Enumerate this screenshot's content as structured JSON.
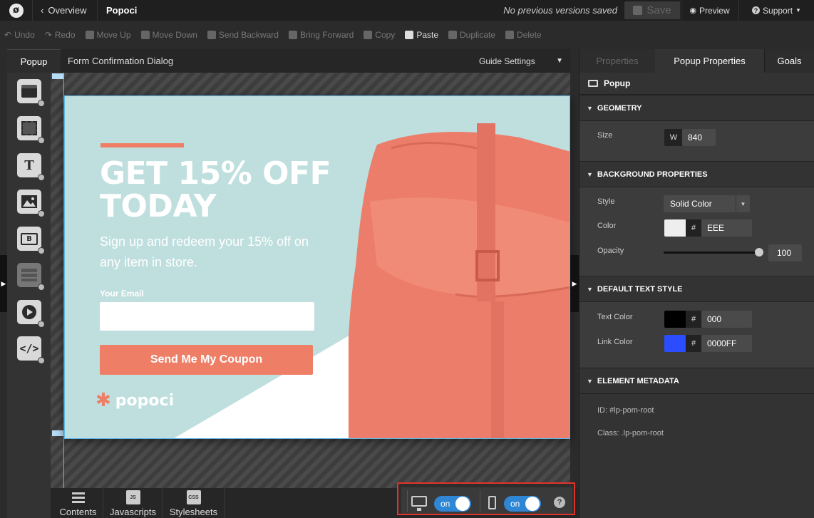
{
  "topbar": {
    "logo_glyph": "ø",
    "overview_label": "Overview",
    "page_name": "Popoci",
    "versions_text": "No previous versions saved",
    "save_label": "Save",
    "preview_label": "Preview",
    "support_label": "Support"
  },
  "toolbar": {
    "undo": "Undo",
    "redo": "Redo",
    "move_up": "Move Up",
    "move_down": "Move Down",
    "send_backward": "Send Backward",
    "bring_forward": "Bring Forward",
    "copy": "Copy",
    "paste": "Paste",
    "duplicate": "Duplicate",
    "delete": "Delete"
  },
  "left_panel": {
    "tab_label": "Popup",
    "tools": [
      {
        "name": "section-tool",
        "glyph": ""
      },
      {
        "name": "box-tool",
        "glyph": ""
      },
      {
        "name": "text-tool",
        "glyph": "T"
      },
      {
        "name": "image-tool",
        "glyph": ""
      },
      {
        "name": "button-tool",
        "glyph": "B"
      },
      {
        "name": "form-tool",
        "glyph": ""
      },
      {
        "name": "video-tool",
        "glyph": ""
      },
      {
        "name": "custom-html-tool",
        "glyph": "</>"
      }
    ]
  },
  "canvas": {
    "title": "Form Confirmation Dialog",
    "guide_settings_label": "Guide Settings",
    "popup": {
      "headline": "GET 15% OFF TODAY",
      "subhead": "Sign up and redeem your 15% off on any item in store.",
      "email_label": "Your Email",
      "email_value": "",
      "button_label": "Send Me My Coupon",
      "brand_name": "popoci",
      "brand_star": "✱",
      "background_color": "#bfdede",
      "accent_color": "#ee7e66"
    }
  },
  "bottom": {
    "tabs": [
      {
        "label": "Contents",
        "icon": "list-icon"
      },
      {
        "label": "Javascripts",
        "icon": "js-file-icon",
        "badge": "JS"
      },
      {
        "label": "Stylesheets",
        "icon": "css-file-icon",
        "badge": "CSS"
      }
    ],
    "desktop_toggle": "on",
    "mobile_toggle": "on",
    "help_glyph": "?"
  },
  "right_panel": {
    "tabs": {
      "properties": "Properties",
      "popup_properties": "Popup Properties",
      "goals": "Goals"
    },
    "element_label": "Popup",
    "geometry": {
      "title": "GEOMETRY",
      "size_label": "Size",
      "width_prefix": "W",
      "width_value": "840"
    },
    "background": {
      "title": "BACKGROUND PROPERTIES",
      "style_label": "Style",
      "style_value": "Solid Color",
      "color_label": "Color",
      "color_value": "EEE",
      "color_swatch": "#eeeeee",
      "opacity_label": "Opacity",
      "opacity_value": "100"
    },
    "text_style": {
      "title": "DEFAULT TEXT STYLE",
      "text_color_label": "Text Color",
      "text_color_value": "000",
      "text_color_swatch": "#000000",
      "link_color_label": "Link Color",
      "link_color_value": "0000FF",
      "link_color_swatch": "#2b4cff"
    },
    "metadata": {
      "title": "ELEMENT METADATA",
      "id_label": "ID:",
      "id_value": "#lp-pom-root",
      "class_label": "Class:",
      "class_value": ".lp-pom-root"
    }
  }
}
